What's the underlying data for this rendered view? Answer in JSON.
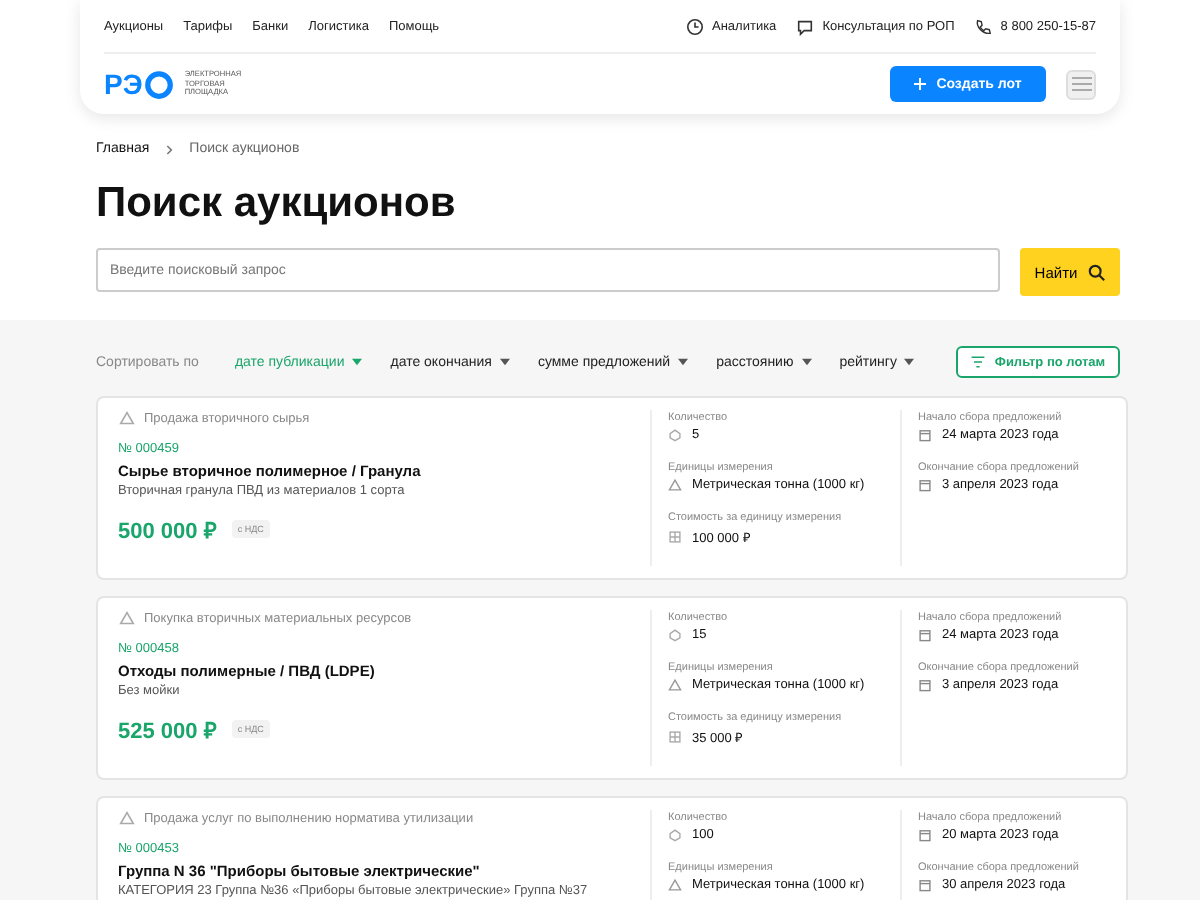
{
  "top_nav": {
    "links": [
      "Аукционы",
      "Тарифы",
      "Банки",
      "Логистика",
      "Помощь"
    ],
    "analytics": "Аналитика",
    "consult": "Консультация по РОП",
    "phone": "8 800 250-15-87"
  },
  "logo": {
    "mark": "РЭ",
    "caption": "ЭЛЕКТРОННАЯ ТОРГОВАЯ ПЛОЩАДКА"
  },
  "create_button": "Создать лот",
  "breadcrumbs": [
    "Главная",
    "Поиск аукционов"
  ],
  "title": "Поиск аукционов",
  "search": {
    "placeholder": "Введите поисковый запрос",
    "button": "Найти"
  },
  "sort": {
    "label": "Сортировать по",
    "options": [
      {
        "label": "дате публикации",
        "selected": true
      },
      {
        "label": "дате окончания",
        "selected": false
      },
      {
        "label": "сумме предложений",
        "selected": false
      },
      {
        "label": "расстоянию",
        "selected": false
      },
      {
        "label": "рейтингу",
        "selected": false
      }
    ],
    "filter_button": "Фильтр по лотам"
  },
  "lots": [
    {
      "type": "Продажа вторичного сырья",
      "number": "№ 000459",
      "name": "Сырье вторичное полимерное / Гранула",
      "description": "Вторичная гранула ПВД из материалов 1 сорта",
      "price": "500 000 ₽",
      "vat": "с НДС",
      "quantity_label": "Количество",
      "quantity": "5",
      "unit_label": "Единицы измерения",
      "unit": "Метрическая тонна (1000 кг)",
      "cost_label": "Стоимость за единицу измерения",
      "cost": "100 000 ₽",
      "start_label": "Начало сбора предложений",
      "start": "24 марта 2023 года",
      "end_label": "Окончание сбора предложений",
      "end": "3 апреля 2023 года"
    },
    {
      "type": "Покупка вторичных материальных ресурсов",
      "number": "№ 000458",
      "name": "Отходы полимерные / ПВД (LDPE)",
      "description": "Без мойки",
      "price": "525 000 ₽",
      "vat": "с НДС",
      "quantity_label": "Количество",
      "quantity": "15",
      "unit_label": "Единицы измерения",
      "unit": "Метрическая тонна (1000 кг)",
      "cost_label": "Стоимость за единицу измерения",
      "cost": "35 000 ₽",
      "start_label": "Начало сбора предложений",
      "start": "24 марта 2023 года",
      "end_label": "Окончание сбора предложений",
      "end": "3 апреля 2023 года"
    },
    {
      "type": "Продажа услуг по выполнению норматива утилизации",
      "number": "№ 000453",
      "name": "Группа N 36 \"Приборы бытовые электрические\"",
      "description": "КАТЕГОРИЯ 23 Группа №36 «Приборы бытовые электрические» Группа №37",
      "quantity_label": "Количество",
      "quantity": "100",
      "unit_label": "Единицы измерения",
      "unit": "Метрическая тонна (1000 кг)",
      "start_label": "Начало сбора предложений",
      "start": "20 марта 2023 года",
      "end_label": "Окончание сбора предложений",
      "end": "30 апреля 2023 года"
    }
  ]
}
